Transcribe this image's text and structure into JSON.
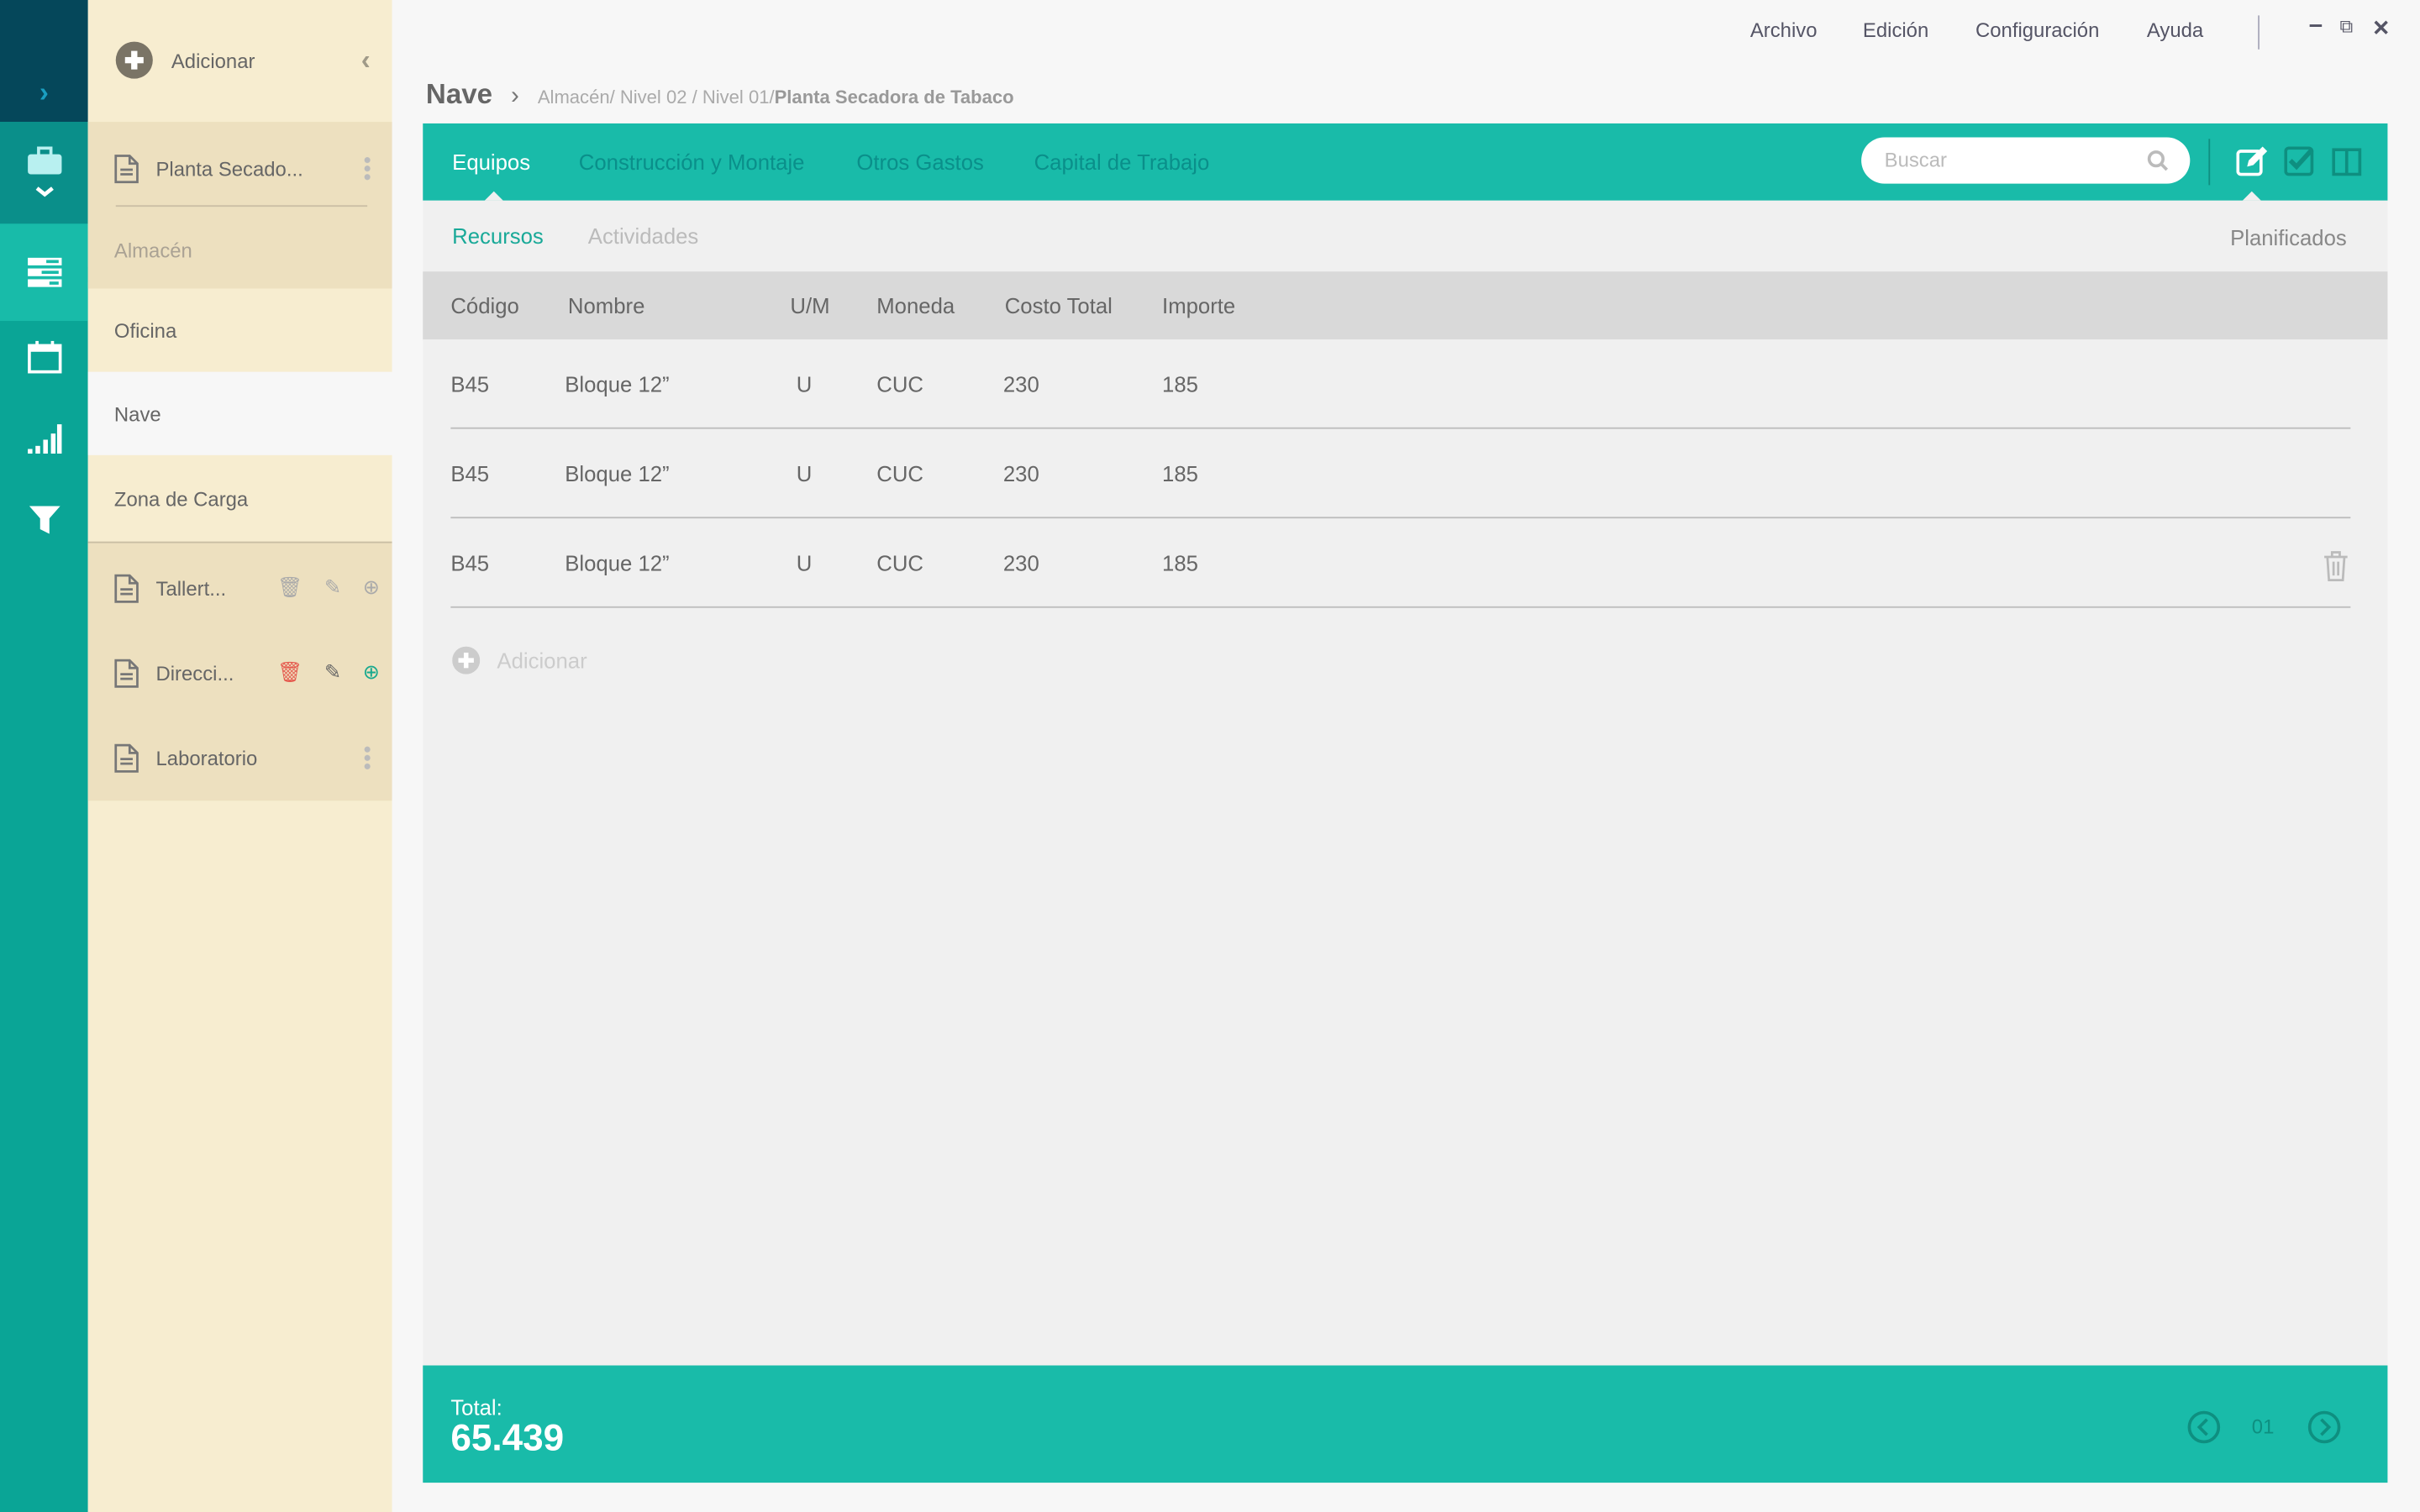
{
  "window": {
    "menu": [
      "Archivo",
      "Edición",
      "Configuración",
      "Ayuda"
    ]
  },
  "rail": {
    "icons": [
      "chevron-right-icon",
      "briefcase-icon",
      "list-icon",
      "calendar-icon",
      "signal-icon",
      "filter-icon"
    ]
  },
  "sidebar": {
    "add_label": "Adicionar",
    "group": "Planta Secado...",
    "subgroup": "Almacén",
    "items": [
      "Oficina",
      "Nave",
      "Zona de Carga"
    ],
    "docs": [
      "Tallert...",
      "Direcci...",
      "Laboratorio"
    ]
  },
  "breadcrumb": {
    "current": "Nave",
    "path": "Almacén/ Nivel 02 / Nivel 01/ ",
    "last": "Planta Secadora de Tabaco"
  },
  "tabs": [
    "Equipos",
    "Construcción y Montaje",
    "Otros Gastos",
    "Capital de Trabajo"
  ],
  "search": {
    "placeholder": "Buscar"
  },
  "subtabs": [
    "Recursos",
    "Actividades"
  ],
  "planificados": "Planificados",
  "table": {
    "headers": [
      "Código",
      "Nombre",
      "U/M",
      "Moneda",
      "Costo Total",
      "Importe"
    ],
    "rows": [
      [
        "B45",
        "Bloque 12”",
        "U",
        "CUC",
        "230",
        "185"
      ],
      [
        "B45",
        "Bloque 12”",
        "U",
        "CUC",
        "230",
        "185"
      ],
      [
        "B45",
        "Bloque 12”",
        "U",
        "CUC",
        "230",
        "185"
      ]
    ]
  },
  "add_row": "Adicionar",
  "footer": {
    "total_label": "Total:",
    "total_value": "65.439",
    "page": "01"
  },
  "colors": {
    "teal": "#19bba9",
    "dark": "#05475a",
    "cream": "#f7edd0",
    "danger": "#e55a4e"
  }
}
